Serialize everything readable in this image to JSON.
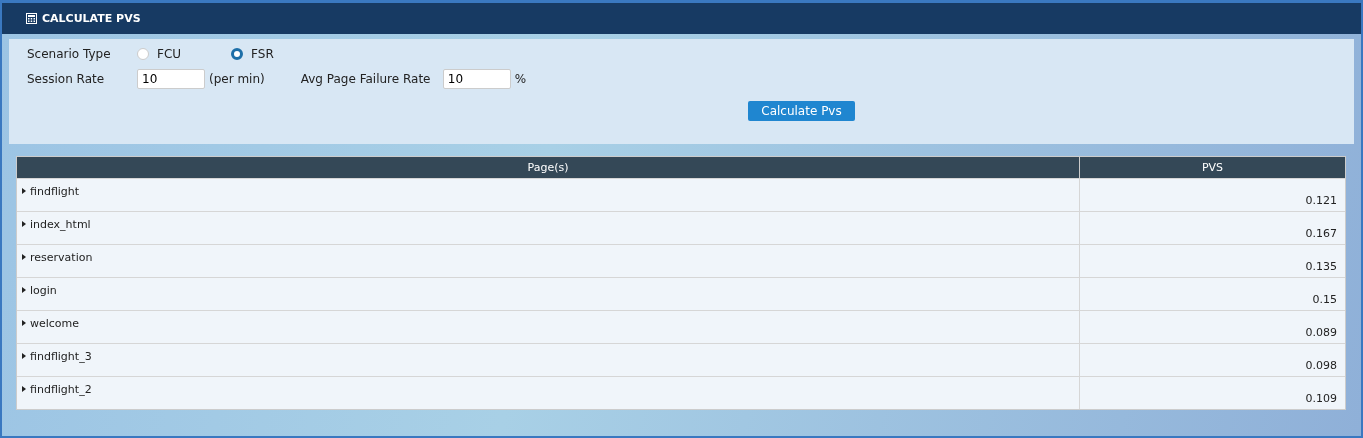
{
  "panel": {
    "title": "CALCULATE PVS"
  },
  "form": {
    "scenario_label": "Scenario Type",
    "scenario_options": [
      {
        "label": "FCU",
        "selected": false
      },
      {
        "label": "FSR",
        "selected": true
      }
    ],
    "session_rate_label": "Session Rate",
    "session_rate_value": "10",
    "session_rate_unit": "(per min)",
    "failure_rate_label": "Avg Page Failure Rate",
    "failure_rate_value": "10",
    "failure_rate_unit": "%",
    "button": "Calculate Pvs"
  },
  "table": {
    "columns": [
      "Page(s)",
      "PVS"
    ],
    "rows": [
      {
        "page": "findflight",
        "pvs": "0.121",
        "expanded": false
      },
      {
        "page": "index_html",
        "pvs": "0.167",
        "expanded": false
      },
      {
        "page": "reservation",
        "pvs": "0.135",
        "expanded": false
      },
      {
        "page": "login",
        "pvs": "0.15",
        "expanded": false
      },
      {
        "page": "welcome",
        "pvs": "0.089",
        "expanded": false
      },
      {
        "page": "findflight_3",
        "pvs": "0.098",
        "expanded": false
      },
      {
        "page": "findflight_2",
        "pvs": "0.109",
        "expanded": false
      }
    ]
  }
}
